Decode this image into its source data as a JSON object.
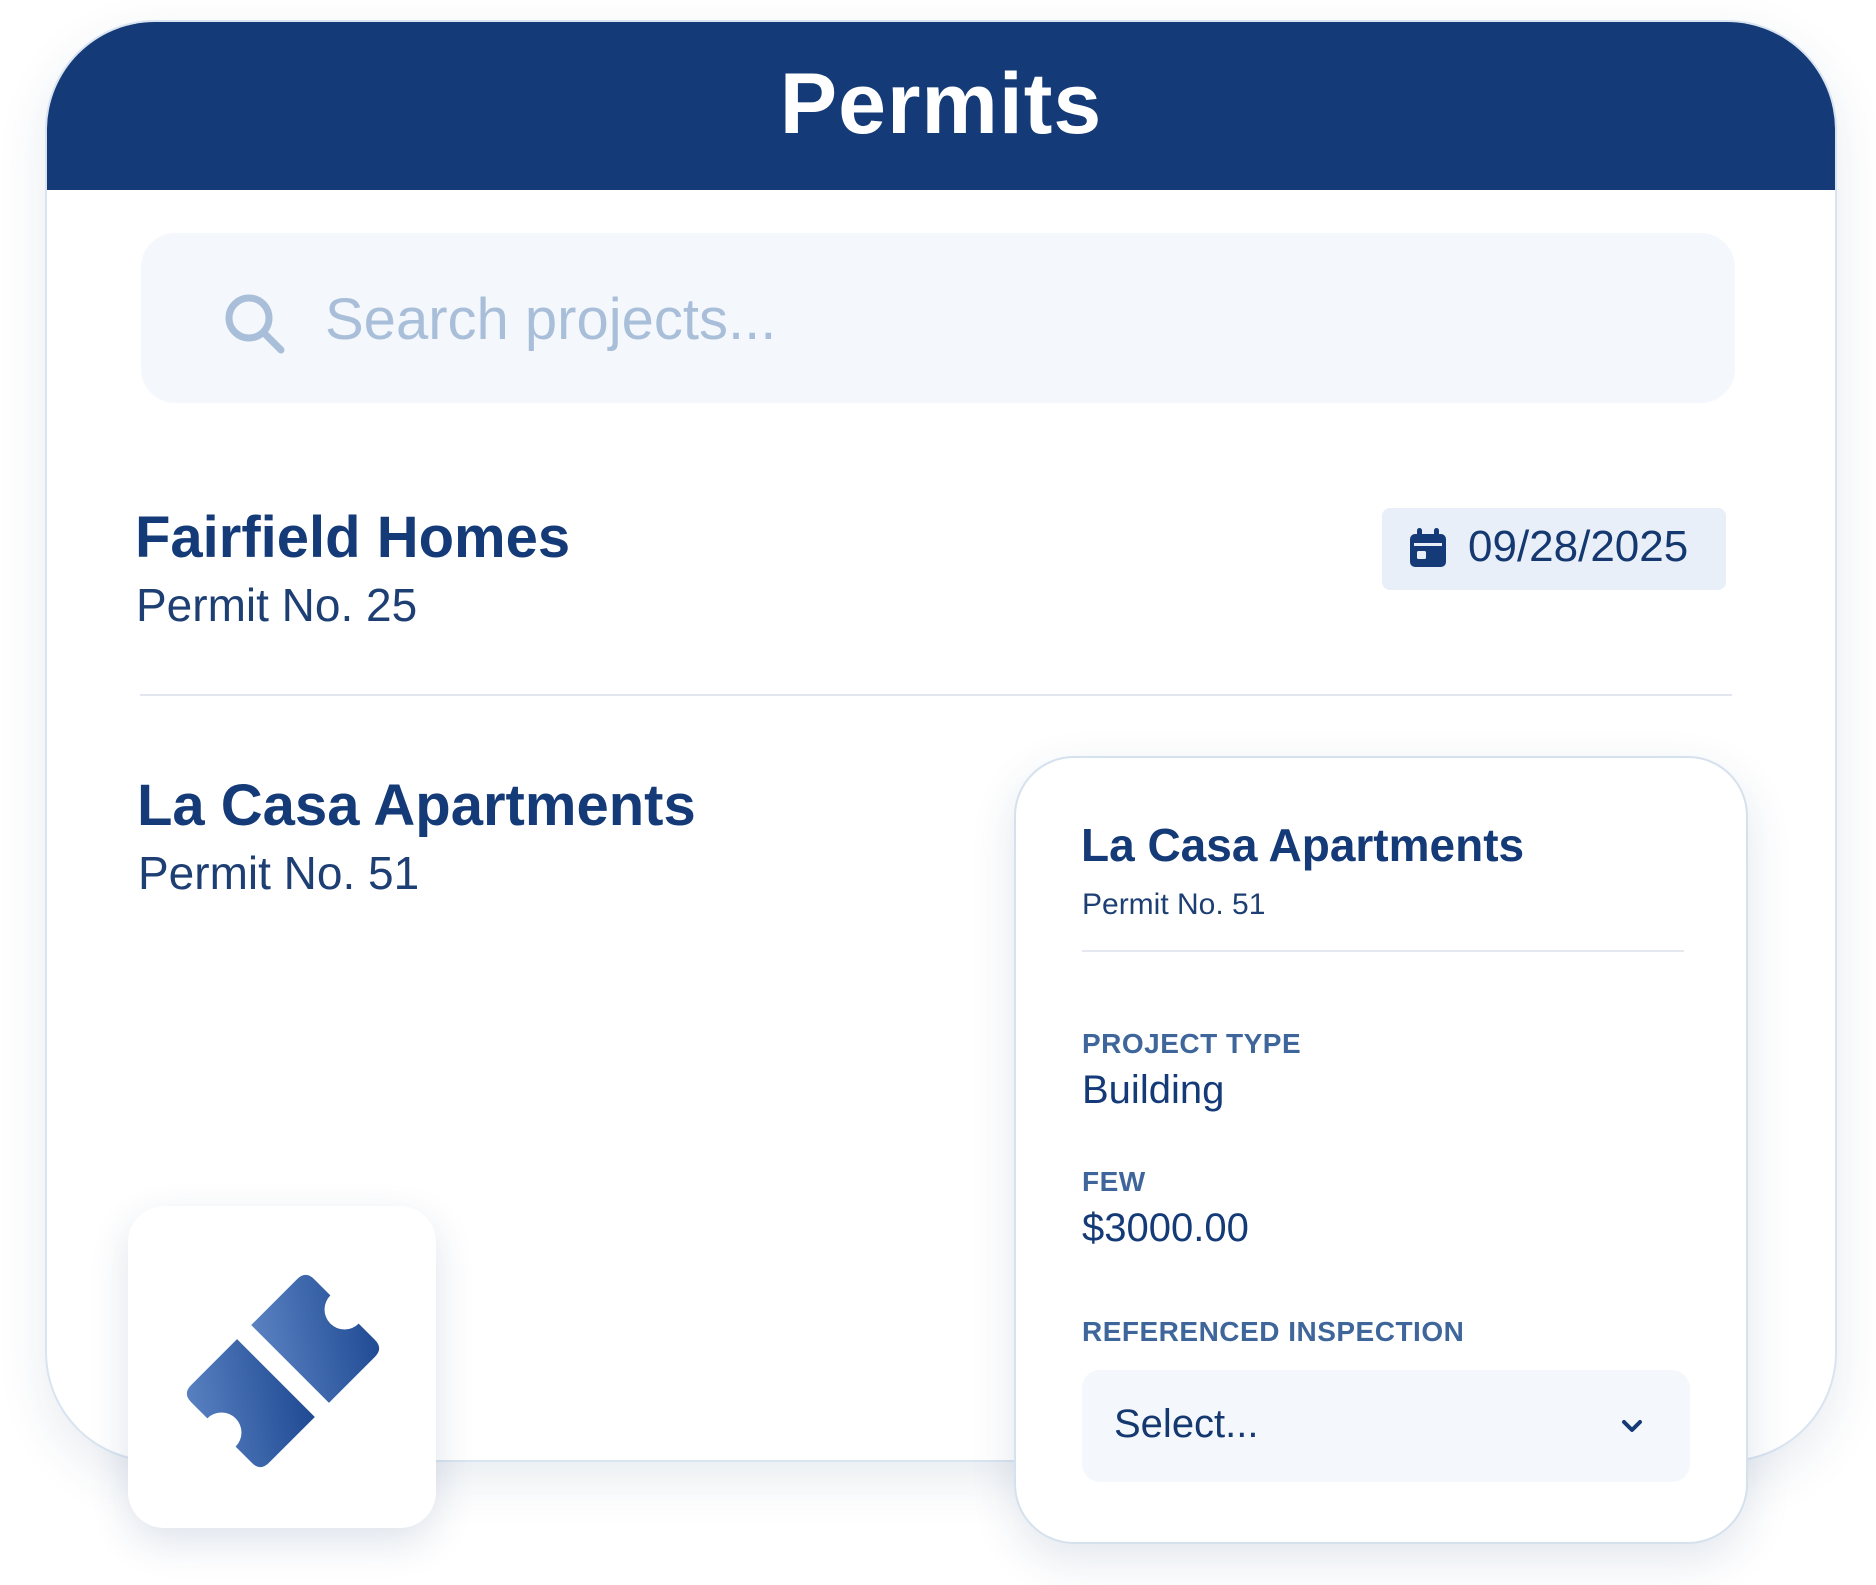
{
  "header": {
    "title": "Permits"
  },
  "search": {
    "placeholder": "Search projects...",
    "value": ""
  },
  "projects": [
    {
      "name": "Fairfield Homes",
      "permit": "Permit No. 25",
      "date": "09/28/2025"
    },
    {
      "name": "La Casa Apartments",
      "permit": "Permit No. 51"
    }
  ],
  "detail": {
    "title": "La Casa Apartments",
    "permit": "Permit No. 51",
    "fields": [
      {
        "label": "PROJECT TYPE",
        "value": "Building"
      },
      {
        "label": "FEW",
        "value": "$3000.00"
      }
    ],
    "inspection_label": "REFERENCED INSPECTION",
    "inspection_select": "Select..."
  },
  "icons": {
    "search": "search-icon",
    "calendar": "calendar-icon",
    "chevron": "chevron-down-icon",
    "ticket": "ticket-icon"
  },
  "colors": {
    "header_bg": "#143a78",
    "primary_text": "#143a78",
    "label_text": "#3f669b",
    "placeholder": "#a9bed8",
    "input_bg": "#f4f8fc",
    "badge_bg": "#e9eff8"
  }
}
